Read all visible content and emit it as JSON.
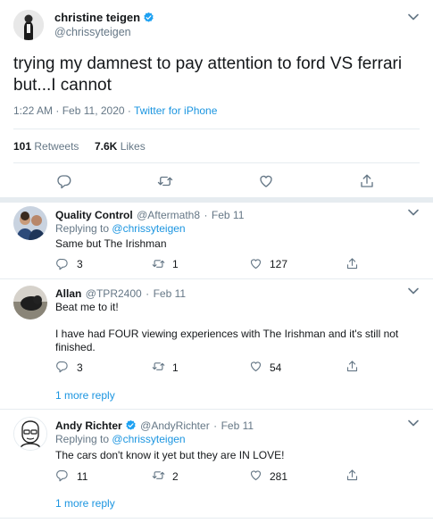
{
  "main_tweet": {
    "display_name": "christine teigen",
    "handle": "@chrissyteigen",
    "text_line1": "trying my damnest to pay attention to ford VS ferrari",
    "text_line2": "but...I cannot",
    "time": "1:22 AM",
    "date": "Feb 11, 2020",
    "separator": "·",
    "source": "Twitter for iPhone",
    "retweets_count": "101",
    "retweets_label": "Retweets",
    "likes_count": "7.6K",
    "likes_label": "Likes"
  },
  "replies": [
    {
      "display_name": "Quality Control",
      "handle": "@Aftermath8",
      "sep": "·",
      "date": "Feb 11",
      "replying_prefix": "Replying to",
      "replying_to": "@chrissyteigen",
      "text": "Same but The Irishman",
      "reply_count": "3",
      "retweet_count": "1",
      "like_count": "127"
    },
    {
      "display_name": "Allan",
      "handle": "@TPR2400",
      "sep": "·",
      "date": "Feb 11",
      "text_line1": "Beat me to it!",
      "text_line2": "I have had FOUR viewing experiences with The Irishman and it's still not",
      "text_line3": "finished.",
      "reply_count": "3",
      "retweet_count": "1",
      "like_count": "54",
      "more_replies": "1 more reply"
    },
    {
      "display_name": "Andy Richter",
      "handle": "@AndyRichter",
      "sep": "·",
      "date": "Feb 11",
      "replying_prefix": "Replying to",
      "replying_to": "@chrissyteigen",
      "text": "The cars don't know it yet but they are IN LOVE!",
      "reply_count": "11",
      "retweet_count": "2",
      "like_count": "281",
      "more_replies": "1 more reply"
    }
  ],
  "colors": {
    "accent": "#1b95e0",
    "muted": "#657786",
    "text": "#14171a",
    "border": "#e6ecf0"
  },
  "icons": [
    "reply-icon",
    "retweet-icon",
    "like-icon",
    "share-icon",
    "chevron-down-icon",
    "verified-badge-icon"
  ]
}
